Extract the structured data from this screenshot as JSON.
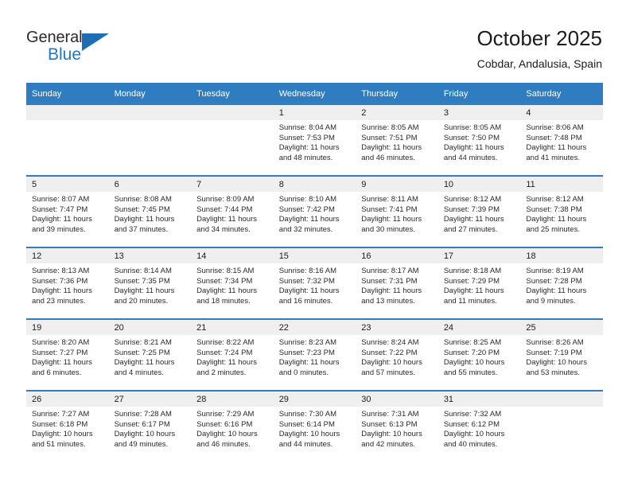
{
  "brand": {
    "name_part1": "General",
    "name_part2": "Blue",
    "triangle_icon": "triangle-icon",
    "color_dark": "#2b2b2b",
    "color_blue": "#2277c9"
  },
  "header": {
    "title": "October 2025",
    "subtitle": "Cobdar, Andalusia, Spain"
  },
  "theme": {
    "header_blue": "#2f7cc0",
    "daynum_band": "#efefef",
    "text": "#2a2a2a"
  },
  "calendar": {
    "weekday_headers": [
      "Sunday",
      "Monday",
      "Tuesday",
      "Wednesday",
      "Thursday",
      "Friday",
      "Saturday"
    ],
    "labels": {
      "sunrise_prefix": "Sunrise:",
      "sunset_prefix": "Sunset:",
      "daylight_prefix": "Daylight:"
    },
    "weeks": [
      [
        {
          "day": "",
          "empty": true
        },
        {
          "day": "",
          "empty": true
        },
        {
          "day": "",
          "empty": true
        },
        {
          "day": "1",
          "sunrise": "Sunrise: 8:04 AM",
          "sunset": "Sunset: 7:53 PM",
          "daylight": "Daylight: 11 hours and 48 minutes."
        },
        {
          "day": "2",
          "sunrise": "Sunrise: 8:05 AM",
          "sunset": "Sunset: 7:51 PM",
          "daylight": "Daylight: 11 hours and 46 minutes."
        },
        {
          "day": "3",
          "sunrise": "Sunrise: 8:05 AM",
          "sunset": "Sunset: 7:50 PM",
          "daylight": "Daylight: 11 hours and 44 minutes."
        },
        {
          "day": "4",
          "sunrise": "Sunrise: 8:06 AM",
          "sunset": "Sunset: 7:48 PM",
          "daylight": "Daylight: 11 hours and 41 minutes."
        }
      ],
      [
        {
          "day": "5",
          "sunrise": "Sunrise: 8:07 AM",
          "sunset": "Sunset: 7:47 PM",
          "daylight": "Daylight: 11 hours and 39 minutes."
        },
        {
          "day": "6",
          "sunrise": "Sunrise: 8:08 AM",
          "sunset": "Sunset: 7:45 PM",
          "daylight": "Daylight: 11 hours and 37 minutes."
        },
        {
          "day": "7",
          "sunrise": "Sunrise: 8:09 AM",
          "sunset": "Sunset: 7:44 PM",
          "daylight": "Daylight: 11 hours and 34 minutes."
        },
        {
          "day": "8",
          "sunrise": "Sunrise: 8:10 AM",
          "sunset": "Sunset: 7:42 PM",
          "daylight": "Daylight: 11 hours and 32 minutes."
        },
        {
          "day": "9",
          "sunrise": "Sunrise: 8:11 AM",
          "sunset": "Sunset: 7:41 PM",
          "daylight": "Daylight: 11 hours and 30 minutes."
        },
        {
          "day": "10",
          "sunrise": "Sunrise: 8:12 AM",
          "sunset": "Sunset: 7:39 PM",
          "daylight": "Daylight: 11 hours and 27 minutes."
        },
        {
          "day": "11",
          "sunrise": "Sunrise: 8:12 AM",
          "sunset": "Sunset: 7:38 PM",
          "daylight": "Daylight: 11 hours and 25 minutes."
        }
      ],
      [
        {
          "day": "12",
          "sunrise": "Sunrise: 8:13 AM",
          "sunset": "Sunset: 7:36 PM",
          "daylight": "Daylight: 11 hours and 23 minutes."
        },
        {
          "day": "13",
          "sunrise": "Sunrise: 8:14 AM",
          "sunset": "Sunset: 7:35 PM",
          "daylight": "Daylight: 11 hours and 20 minutes."
        },
        {
          "day": "14",
          "sunrise": "Sunrise: 8:15 AM",
          "sunset": "Sunset: 7:34 PM",
          "daylight": "Daylight: 11 hours and 18 minutes."
        },
        {
          "day": "15",
          "sunrise": "Sunrise: 8:16 AM",
          "sunset": "Sunset: 7:32 PM",
          "daylight": "Daylight: 11 hours and 16 minutes."
        },
        {
          "day": "16",
          "sunrise": "Sunrise: 8:17 AM",
          "sunset": "Sunset: 7:31 PM",
          "daylight": "Daylight: 11 hours and 13 minutes."
        },
        {
          "day": "17",
          "sunrise": "Sunrise: 8:18 AM",
          "sunset": "Sunset: 7:29 PM",
          "daylight": "Daylight: 11 hours and 11 minutes."
        },
        {
          "day": "18",
          "sunrise": "Sunrise: 8:19 AM",
          "sunset": "Sunset: 7:28 PM",
          "daylight": "Daylight: 11 hours and 9 minutes."
        }
      ],
      [
        {
          "day": "19",
          "sunrise": "Sunrise: 8:20 AM",
          "sunset": "Sunset: 7:27 PM",
          "daylight": "Daylight: 11 hours and 6 minutes."
        },
        {
          "day": "20",
          "sunrise": "Sunrise: 8:21 AM",
          "sunset": "Sunset: 7:25 PM",
          "daylight": "Daylight: 11 hours and 4 minutes."
        },
        {
          "day": "21",
          "sunrise": "Sunrise: 8:22 AM",
          "sunset": "Sunset: 7:24 PM",
          "daylight": "Daylight: 11 hours and 2 minutes."
        },
        {
          "day": "22",
          "sunrise": "Sunrise: 8:23 AM",
          "sunset": "Sunset: 7:23 PM",
          "daylight": "Daylight: 11 hours and 0 minutes."
        },
        {
          "day": "23",
          "sunrise": "Sunrise: 8:24 AM",
          "sunset": "Sunset: 7:22 PM",
          "daylight": "Daylight: 10 hours and 57 minutes."
        },
        {
          "day": "24",
          "sunrise": "Sunrise: 8:25 AM",
          "sunset": "Sunset: 7:20 PM",
          "daylight": "Daylight: 10 hours and 55 minutes."
        },
        {
          "day": "25",
          "sunrise": "Sunrise: 8:26 AM",
          "sunset": "Sunset: 7:19 PM",
          "daylight": "Daylight: 10 hours and 53 minutes."
        }
      ],
      [
        {
          "day": "26",
          "sunrise": "Sunrise: 7:27 AM",
          "sunset": "Sunset: 6:18 PM",
          "daylight": "Daylight: 10 hours and 51 minutes."
        },
        {
          "day": "27",
          "sunrise": "Sunrise: 7:28 AM",
          "sunset": "Sunset: 6:17 PM",
          "daylight": "Daylight: 10 hours and 49 minutes."
        },
        {
          "day": "28",
          "sunrise": "Sunrise: 7:29 AM",
          "sunset": "Sunset: 6:16 PM",
          "daylight": "Daylight: 10 hours and 46 minutes."
        },
        {
          "day": "29",
          "sunrise": "Sunrise: 7:30 AM",
          "sunset": "Sunset: 6:14 PM",
          "daylight": "Daylight: 10 hours and 44 minutes."
        },
        {
          "day": "30",
          "sunrise": "Sunrise: 7:31 AM",
          "sunset": "Sunset: 6:13 PM",
          "daylight": "Daylight: 10 hours and 42 minutes."
        },
        {
          "day": "31",
          "sunrise": "Sunrise: 7:32 AM",
          "sunset": "Sunset: 6:12 PM",
          "daylight": "Daylight: 10 hours and 40 minutes."
        },
        {
          "day": "",
          "empty": true
        }
      ]
    ]
  }
}
